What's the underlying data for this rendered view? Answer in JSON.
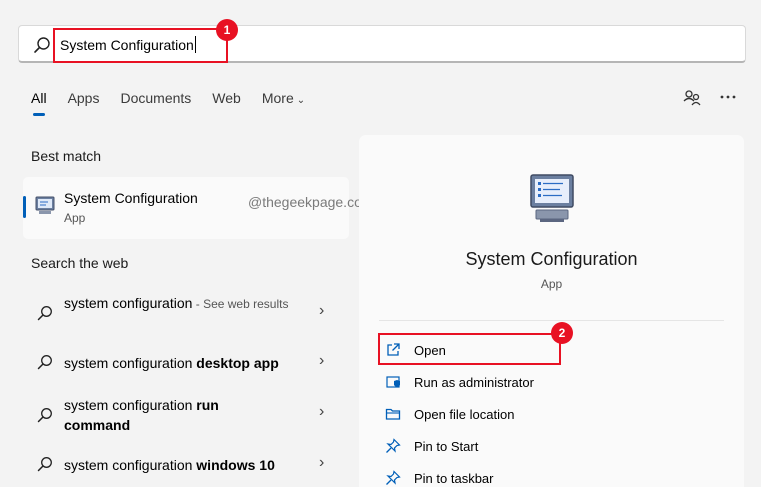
{
  "search": {
    "value": "System Configuration",
    "placeholder": ""
  },
  "callouts": [
    "1",
    "2"
  ],
  "tabs": [
    {
      "label": "All",
      "active": true
    },
    {
      "label": "Apps"
    },
    {
      "label": "Documents"
    },
    {
      "label": "Web"
    },
    {
      "label": "More"
    }
  ],
  "best_match": {
    "heading": "Best match",
    "title": "System Configuration",
    "subtitle": "App"
  },
  "watermark": "@thegeekpage.com",
  "search_web": {
    "heading": "Search the web",
    "items": [
      {
        "prefix": "system configuration",
        "bold": "",
        "suffix": " - See web results"
      },
      {
        "prefix": "system configuration ",
        "bold": "desktop app",
        "suffix": ""
      },
      {
        "prefix": "system configuration ",
        "bold": "run command",
        "suffix": ""
      },
      {
        "prefix": "system configuration ",
        "bold": "windows 10",
        "suffix": ""
      }
    ]
  },
  "details": {
    "title": "System Configuration",
    "subtitle": "App",
    "actions": [
      {
        "label": "Open",
        "icon": "open-external-icon"
      },
      {
        "label": "Run as administrator",
        "icon": "shield-icon"
      },
      {
        "label": "Open file location",
        "icon": "folder-icon"
      },
      {
        "label": "Pin to Start",
        "icon": "pin-icon"
      },
      {
        "label": "Pin to taskbar",
        "icon": "pin-icon"
      }
    ]
  },
  "colors": {
    "accent": "#005fb8",
    "callout": "#e81123",
    "background": "#f3f3f3"
  }
}
